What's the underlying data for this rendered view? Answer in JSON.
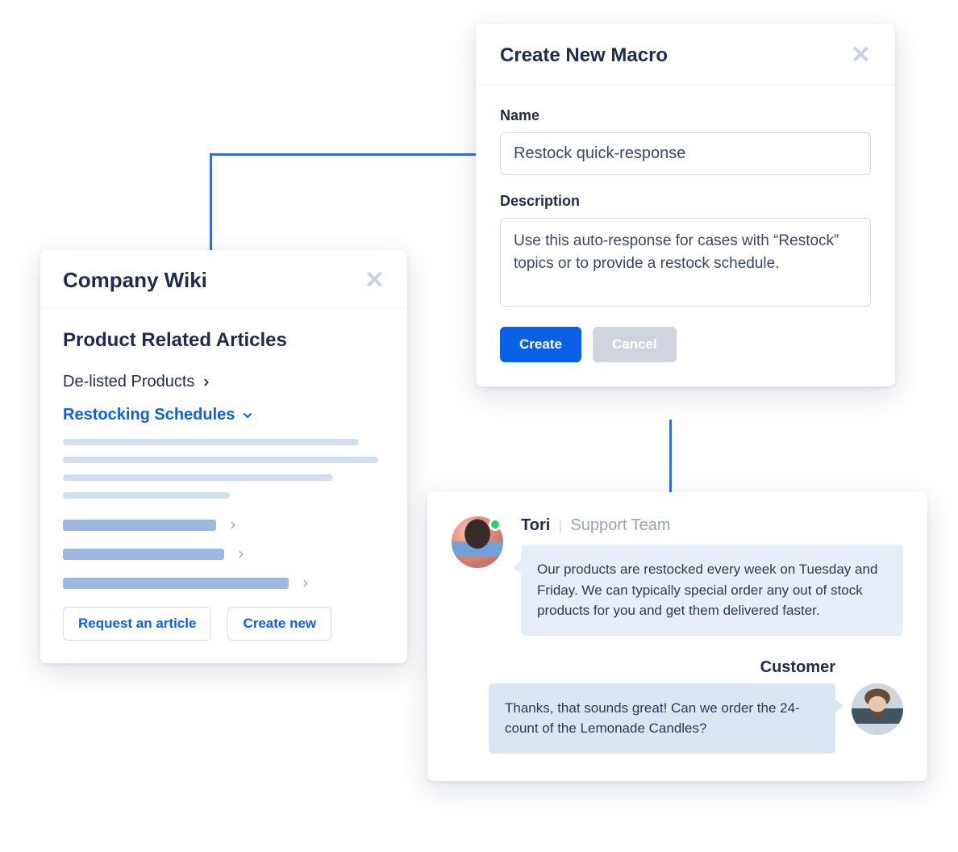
{
  "wiki": {
    "title": "Company Wiki",
    "section_heading": "Product Related Articles",
    "articles": [
      {
        "label": "De-listed Products",
        "expanded": false
      },
      {
        "label": "Restocking Schedules",
        "expanded": true
      }
    ],
    "footer": {
      "request_label": "Request an article",
      "create_label": "Create new"
    }
  },
  "macro": {
    "title": "Create New Macro",
    "name_label": "Name",
    "name_value": "Restock quick-response",
    "description_label": "Description",
    "description_value": "Use this auto-response for cases with “Restock” topics or to provide a restock schedule.",
    "create_label": "Create",
    "cancel_label": "Cancel"
  },
  "chat": {
    "agent_name": "Tori",
    "agent_team": "Support Team",
    "agent_message": "Our products are restocked every week on Tuesday and Friday. We can typically special order any out of stock products for you and get them delivered faster.",
    "customer_label": "Customer",
    "customer_message": "Thanks, that sounds great! Can we order the 24-count of the Lemonade Candles?"
  },
  "colors": {
    "accent": "#0b61e6",
    "text": "#1e2b4a",
    "muted": "#9aa3b2",
    "online": "#2ecc71"
  }
}
